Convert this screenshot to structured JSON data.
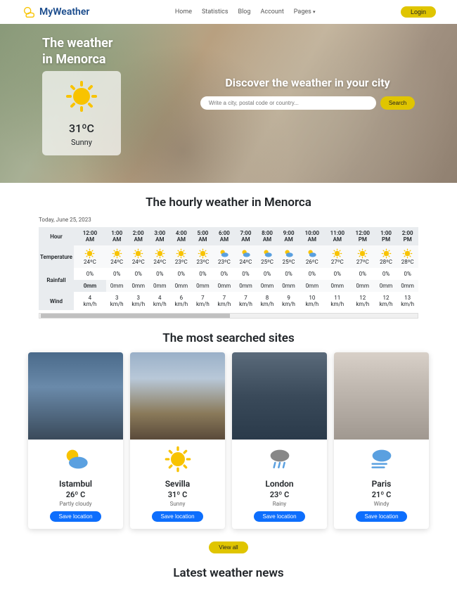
{
  "brand": "MyWeather",
  "nav": [
    "Home",
    "Statistics",
    "Blog",
    "Account",
    "Pages"
  ],
  "login": "Login",
  "hero": {
    "line1": "The weather",
    "line2": "in Menorca",
    "temp": "31ºC",
    "cond": "Sunny",
    "discover": "Discover the weather in your city",
    "placeholder": "Write a city, postal code or country...",
    "search": "Search"
  },
  "hourly_title": "The hourly weather in Menorca",
  "date": "Today, June 25, 2023",
  "headers": {
    "hour": "Hour",
    "temp": "Temperature",
    "rain": "Rainfall",
    "wind": "Wind"
  },
  "hours": [
    {
      "t": "12:00 AM",
      "ic": "sun",
      "temp": "24ºC",
      "r1": "0%",
      "r2": "0mm",
      "w": "4 km/h"
    },
    {
      "t": "1:00 AM",
      "ic": "sun",
      "temp": "24ºC",
      "r1": "0%",
      "r2": "0mm",
      "w": "3 km/h"
    },
    {
      "t": "2:00 AM",
      "ic": "sun",
      "temp": "24ºC",
      "r1": "0%",
      "r2": "0mm",
      "w": "3 km/h"
    },
    {
      "t": "3:00 AM",
      "ic": "sun",
      "temp": "24ºC",
      "r1": "0%",
      "r2": "0mm",
      "w": "4 km/h"
    },
    {
      "t": "4:00 AM",
      "ic": "sun",
      "temp": "23ºC",
      "r1": "0%",
      "r2": "0mm",
      "w": "6 km/h"
    },
    {
      "t": "5:00 AM",
      "ic": "sun",
      "temp": "23ºC",
      "r1": "0%",
      "r2": "0mm",
      "w": "7 km/h"
    },
    {
      "t": "6:00 AM",
      "ic": "partly",
      "temp": "23ºC",
      "r1": "0%",
      "r2": "0mm",
      "w": "7 km/h"
    },
    {
      "t": "7:00 AM",
      "ic": "partly",
      "temp": "24ºC",
      "r1": "0%",
      "r2": "0mm",
      "w": "7 km/h"
    },
    {
      "t": "8:00 AM",
      "ic": "partly",
      "temp": "25ºC",
      "r1": "0%",
      "r2": "0mm",
      "w": "8 km/h"
    },
    {
      "t": "9:00 AM",
      "ic": "partly",
      "temp": "25ºC",
      "r1": "0%",
      "r2": "0mm",
      "w": "9 km/h"
    },
    {
      "t": "10:00 AM",
      "ic": "partly",
      "temp": "26ºC",
      "r1": "0%",
      "r2": "0mm",
      "w": "10 km/h"
    },
    {
      "t": "11:00 AM",
      "ic": "sun",
      "temp": "27ºC",
      "r1": "0%",
      "r2": "0mm",
      "w": "11 km/h"
    },
    {
      "t": "12:00 PM",
      "ic": "sun",
      "temp": "27ºC",
      "r1": "0%",
      "r2": "0mm",
      "w": "12 km/h"
    },
    {
      "t": "1:00 PM",
      "ic": "sun",
      "temp": "28ºC",
      "r1": "0%",
      "r2": "0mm",
      "w": "12 km/h"
    },
    {
      "t": "2:00 PM",
      "ic": "sun",
      "temp": "28ºC",
      "r1": "0%",
      "r2": "0mm",
      "w": "13 km/h"
    }
  ],
  "most_title": "The most searched sites",
  "sites": [
    {
      "name": "Istambul",
      "temp": "26º C",
      "cond": "Partly cloudy",
      "ic": "partly",
      "img": "img-istanbul"
    },
    {
      "name": "Sevilla",
      "temp": "31º C",
      "cond": "Sunny",
      "ic": "sun",
      "img": "img-sevilla"
    },
    {
      "name": "London",
      "temp": "23º C",
      "cond": "Rainy",
      "ic": "rain",
      "img": "img-london"
    },
    {
      "name": "Paris",
      "temp": "21º C",
      "cond": "Windy",
      "ic": "windy",
      "img": "img-paris"
    }
  ],
  "save": "Save location",
  "view_all": "View all",
  "news_title": "Latest weather news"
}
